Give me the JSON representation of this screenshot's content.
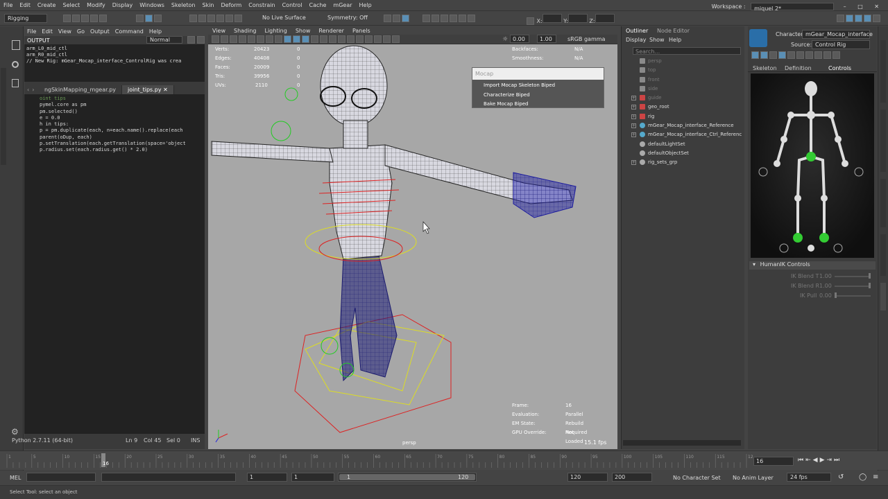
{
  "menubar": {
    "items": [
      "File",
      "Edit",
      "Create",
      "Select",
      "Modify",
      "Display",
      "Windows",
      "Skeleton",
      "Skin",
      "Deform",
      "Constrain",
      "Control",
      "Cache",
      "mGear",
      "Help"
    ],
    "workspace_label": "Workspace :",
    "workspace_value": "miquel 2*"
  },
  "shelf": {
    "mode": "Rigging",
    "live_surface": "No Live Surface",
    "symmetry": "Symmetry: Off",
    "x_label": "X:",
    "y_label": "Y:",
    "z_label": "Z:"
  },
  "script_editor": {
    "menus": [
      "File",
      "Edit",
      "View",
      "Go",
      "Output",
      "Command",
      "Help"
    ],
    "output_label": "OUTPUT",
    "mode": "Normal",
    "output_lines": [
      "arm_L0_mid_ctl",
      "arm_R0_mid_ctl",
      "// New Rig: mGear_Mocap_interface_ControlRig was crea"
    ],
    "tabs": [
      "ngSkinMapping_mgear.py",
      "joint_tips.py"
    ],
    "code_lines": [
      "oint tips",
      "pymel.core as pm",
      "pm.selected()",
      "e = 0.0",
      "h in tips:",
      "p = pm.duplicate(each, n=each.name().replace(each",
      "parent(oDup, each)",
      "p.setTranslation(each.getTranslation(space='object",
      "p.radius.set(each.radius.get() * 2.0)"
    ],
    "status_python": "Python 2.7.11 (64-bit)",
    "status_ln": "Ln 9",
    "status_col": "Col 45",
    "status_sel": "Sel 0",
    "status_ins": "INS"
  },
  "viewport": {
    "menus": [
      "View",
      "Shading",
      "Lighting",
      "Show",
      "Renderer",
      "Panels"
    ],
    "exposure": "0.00",
    "gamma": "1.00",
    "colorspace": "sRGB gamma",
    "stats_left": [
      {
        "k": "Verts:",
        "v": "20423",
        "v2": "0"
      },
      {
        "k": "Edges:",
        "v": "40408",
        "v2": "0"
      },
      {
        "k": "Faces:",
        "v": "20009",
        "v2": "0"
      },
      {
        "k": "Tris:",
        "v": "39956",
        "v2": "0"
      },
      {
        "k": "UVs:",
        "v": "2110",
        "v2": "0"
      }
    ],
    "stats_right": [
      {
        "k": "Backfaces:",
        "v": "N/A"
      },
      {
        "k": "Smoothness:",
        "v": "N/A"
      }
    ],
    "hud_bottom": [
      {
        "k": "Frame:",
        "v": "16"
      },
      {
        "k": "Evaluation:",
        "v": "Parallel"
      },
      {
        "k": "EM State:",
        "v": "Rebuild Required"
      },
      {
        "k": "GPU Override:",
        "v": "Not Loaded"
      }
    ],
    "fps": "15.1 fps",
    "camera": "persp"
  },
  "mocap_popup": {
    "title": "Mocap",
    "items": [
      "Import Mocap Skeleton Biped",
      "Characterize Biped",
      "Bake Mocap Biped"
    ]
  },
  "outliner": {
    "tabs": [
      "Outliner",
      "Node Editor"
    ],
    "menus": [
      "Display",
      "Show",
      "Help"
    ],
    "search_placeholder": "Search...",
    "items": [
      {
        "label": "persp",
        "dim": true,
        "expand": false
      },
      {
        "label": "top",
        "dim": true,
        "expand": false
      },
      {
        "label": "front",
        "dim": true,
        "expand": false
      },
      {
        "label": "side",
        "dim": true,
        "expand": false
      },
      {
        "label": "guide",
        "dim": true,
        "expand": true
      },
      {
        "label": "geo_root",
        "dim": false,
        "expand": true
      },
      {
        "label": "rig",
        "dim": false,
        "expand": true
      },
      {
        "label": "mGear_Mocap_interface_Reference",
        "dim": false,
        "expand": true
      },
      {
        "label": "mGear_Mocap_interface_Ctrl_Referenc",
        "dim": false,
        "expand": true
      },
      {
        "label": "defaultLightSet",
        "dim": false,
        "expand": false
      },
      {
        "label": "defaultObjectSet",
        "dim": false,
        "expand": false
      },
      {
        "label": "rig_sets_grp",
        "dim": false,
        "expand": true
      }
    ]
  },
  "humanik": {
    "character_label": "Character:",
    "character_value": "mGear_Mocap_interface",
    "source_label": "Source:",
    "source_value": "Control Rig",
    "tabs": [
      "Skeleton",
      "Definition",
      "Controls"
    ],
    "controls_title": "HumanIK Controls",
    "sliders": [
      {
        "label": "IK Blend T",
        "value": "1.00"
      },
      {
        "label": "IK Blend R",
        "value": "1.00"
      },
      {
        "label": "IK Pull",
        "value": "0.00"
      }
    ]
  },
  "timeline": {
    "ticks": [
      "1",
      "5",
      "10",
      "15",
      "20",
      "25",
      "30",
      "35",
      "40",
      "45",
      "50",
      "55",
      "60",
      "65",
      "70",
      "75",
      "80",
      "85",
      "90",
      "95",
      "100",
      "105",
      "110",
      "115",
      "120"
    ],
    "current_frame": "16",
    "current_field": "16"
  },
  "range": {
    "mel_label": "MEL",
    "start": "1",
    "start2": "1",
    "slider_start": "1",
    "slider_end": "120",
    "end": "120",
    "end2": "200",
    "char_set": "No Character Set",
    "anim_layer": "No Anim Layer",
    "fps": "24 fps"
  },
  "status_bar": {
    "text": "Select Tool: select an object"
  }
}
